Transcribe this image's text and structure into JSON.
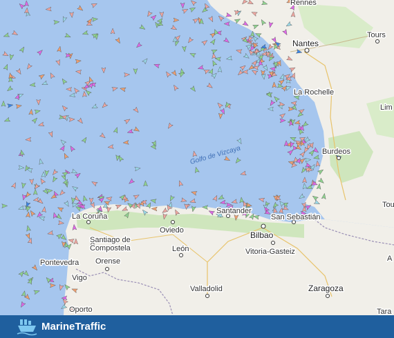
{
  "map": {
    "sea_label": "Golfo de Vizcaya",
    "cities": [
      {
        "key": "rennes",
        "name": "Rennes"
      },
      {
        "key": "nantes",
        "name": "Nantes"
      },
      {
        "key": "tours",
        "name": "Tours"
      },
      {
        "key": "la-rochelle",
        "name": "La Rochelle"
      },
      {
        "key": "limoges",
        "name": "Lim"
      },
      {
        "key": "bordeaux",
        "name": "Burdeos"
      },
      {
        "key": "la-coruna",
        "name": "La Coruña"
      },
      {
        "key": "santiago",
        "name": "Santiago de Compostela"
      },
      {
        "key": "oviedo",
        "name": "Oviedo"
      },
      {
        "key": "santander",
        "name": "Santander"
      },
      {
        "key": "bilbao",
        "name": "Bilbao"
      },
      {
        "key": "san-sebastian",
        "name": "San Sebastián"
      },
      {
        "key": "leon",
        "name": "León"
      },
      {
        "key": "vitoria",
        "name": "Vitoria-Gasteiz"
      },
      {
        "key": "ourense",
        "name": "Orense"
      },
      {
        "key": "pontevedra",
        "name": "Pontevedra"
      },
      {
        "key": "vigo",
        "name": "Vigo"
      },
      {
        "key": "oporto",
        "name": "Oporto"
      },
      {
        "key": "valladolid",
        "name": "Valladolid"
      },
      {
        "key": "zaragoza",
        "name": "Zaragoza"
      },
      {
        "key": "tou",
        "name": "Tou"
      },
      {
        "key": "tara",
        "name": "Tara"
      },
      {
        "key": "a",
        "name": "A"
      }
    ],
    "colors": {
      "sea": "#a6c6ee",
      "land": "#f1efe9",
      "vegetation": "#cfe6bd",
      "cargo_ship": "#8fd48f",
      "tanker_ship": "#f0a6a0",
      "passenger_ship": "#3a86e8",
      "fishing_ship": "#f0a070",
      "pleasure_ship": "#e067e8",
      "other_ship": "#9ad9e8"
    }
  },
  "footer": {
    "brand": "MarineTraffic",
    "logo_icon": "ship-logo-icon"
  }
}
